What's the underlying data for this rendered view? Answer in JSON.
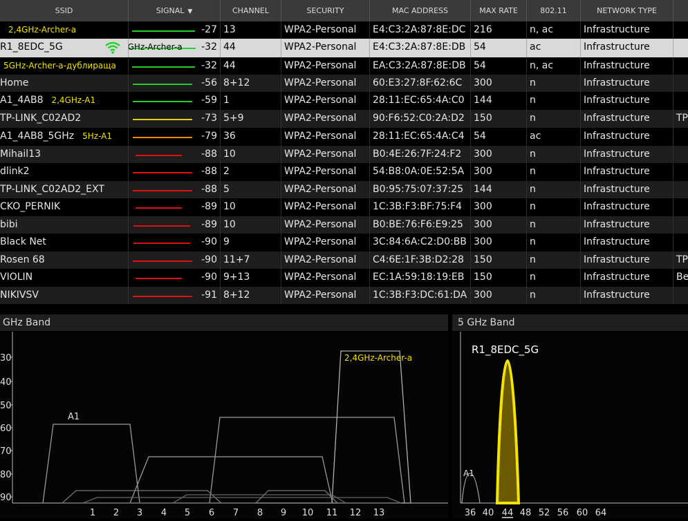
{
  "columns": [
    {
      "key": "ssid",
      "label": "SSID"
    },
    {
      "key": "signal",
      "label": "SIGNAL",
      "sort": "▼"
    },
    {
      "key": "channel",
      "label": "CHANNEL"
    },
    {
      "key": "security",
      "label": "SECURITY"
    },
    {
      "key": "mac",
      "label": "MAC ADDRESS"
    },
    {
      "key": "rate",
      "label": "MAX RATE"
    },
    {
      "key": "std",
      "label": "802.11"
    },
    {
      "key": "nettype",
      "label": "NETWORK TYPE"
    }
  ],
  "rows": [
    {
      "ssid": "",
      "note": "2,4GHz-Archer-a",
      "signal": "-27",
      "bar_fraction": 0.95,
      "bar_color": "#25d12b",
      "channel": "13",
      "security": "WPA2-Personal",
      "mac": "E4:C3:2A:87:8E:DC",
      "rate": "216",
      "std": "n, ac",
      "nettype": "Infrastructure",
      "extra": ""
    },
    {
      "ssid": "R1_8EDC_5G",
      "note": "5GHz-Archer-a",
      "signal": "-32",
      "bar_fraction": 0.95,
      "bar_color": "#25d12b",
      "channel": "44",
      "security": "WPA2-Personal",
      "mac": "E4:C3:2A:87:8E:DB",
      "rate": "54",
      "std": "ac",
      "nettype": "Infrastructure",
      "extra": "",
      "selected": true,
      "connected": true
    },
    {
      "ssid": "",
      "note": "5GHz-Archer-a-дублираща",
      "signal": "-32",
      "bar_fraction": 0.95,
      "bar_color": "#25d12b",
      "channel": "44",
      "security": "WPA2-Personal",
      "mac": "EA:C3:2A:87:8E:DB",
      "rate": "54",
      "std": "n, ac",
      "nettype": "Infrastructure",
      "extra": ""
    },
    {
      "ssid": "Home",
      "note": "",
      "signal": "-56",
      "bar_fraction": 0.9,
      "bar_color": "#25d12b",
      "channel": "8+12",
      "security": "WPA2-Personal",
      "mac": "60:E3:27:8F:62:6C",
      "rate": "300",
      "std": "n",
      "nettype": "Infrastructure",
      "extra": ""
    },
    {
      "ssid": "A1_4AB8",
      "note": "2,4GHz-A1",
      "signal": "-59",
      "bar_fraction": 0.9,
      "bar_color": "#25d12b",
      "channel": "1",
      "security": "WPA2-Personal",
      "mac": "28:11:EC:65:4A:C0",
      "rate": "144",
      "std": "n",
      "nettype": "Infrastructure",
      "extra": ""
    },
    {
      "ssid": "TP-LINK_C02AD2",
      "note": "",
      "signal": "-73",
      "bar_fraction": 0.9,
      "bar_color": "#e6d200",
      "channel": "5+9",
      "security": "WPA2-Personal",
      "mac": "90:F6:52:C0:2A:D2",
      "rate": "150",
      "std": "n",
      "nettype": "Infrastructure",
      "extra": "TP"
    },
    {
      "ssid": "A1_4AB8_5GHz",
      "note": "5Hz-A1",
      "signal": "-79",
      "bar_fraction": 0.9,
      "bar_color": "#f08a00",
      "channel": "36",
      "security": "WPA2-Personal",
      "mac": "28:11:EC:65:4A:C4",
      "rate": "54",
      "std": "ac",
      "nettype": "Infrastructure",
      "extra": ""
    },
    {
      "ssid": "Mihail13",
      "note": "",
      "signal": "-88",
      "bar_fraction": 0.7,
      "bar_color": "#e01010",
      "channel": "10",
      "security": "WPA2-Personal",
      "mac": "B0:4E:26:7F:24:F2",
      "rate": "300",
      "std": "n",
      "nettype": "Infrastructure",
      "extra": ""
    },
    {
      "ssid": "dlink2",
      "note": "",
      "signal": "-88",
      "bar_fraction": 0.9,
      "bar_color": "#e01010",
      "channel": "2",
      "security": "WPA2-Personal",
      "mac": "54:B8:0A:0E:52:5A",
      "rate": "300",
      "std": "n",
      "nettype": "Infrastructure",
      "extra": ""
    },
    {
      "ssid": "TP-LINK_C02AD2_EXT",
      "note": "",
      "signal": "-88",
      "bar_fraction": 0.9,
      "bar_color": "#e01010",
      "channel": "5",
      "security": "WPA2-Personal",
      "mac": "B0:95:75:07:37:25",
      "rate": "144",
      "std": "n",
      "nettype": "Infrastructure",
      "extra": ""
    },
    {
      "ssid": "CKO_PERNIK",
      "note": "",
      "signal": "-89",
      "bar_fraction": 0.7,
      "bar_color": "#e01010",
      "channel": "10",
      "security": "WPA2-Personal",
      "mac": "1C:3B:F3:BF:75:F4",
      "rate": "300",
      "std": "n",
      "nettype": "Infrastructure",
      "extra": ""
    },
    {
      "ssid": "bibi",
      "note": "",
      "signal": "-89",
      "bar_fraction": 0.85,
      "bar_color": "#e01010",
      "channel": "10",
      "security": "WPA2-Personal",
      "mac": "B0:BE:76:F6:E9:25",
      "rate": "300",
      "std": "n",
      "nettype": "Infrastructure",
      "extra": ""
    },
    {
      "ssid": "Black Net",
      "note": "",
      "signal": "-90",
      "bar_fraction": 0.85,
      "bar_color": "#e01010",
      "channel": "9",
      "security": "WPA2-Personal",
      "mac": "3C:84:6A:C2:D0:BB",
      "rate": "300",
      "std": "n",
      "nettype": "Infrastructure",
      "extra": ""
    },
    {
      "ssid": "Rosen 68",
      "note": "",
      "signal": "-90",
      "bar_fraction": 0.9,
      "bar_color": "#e01010",
      "channel": "11+7",
      "security": "WPA2-Personal",
      "mac": "C4:6E:1F:3B:D2:28",
      "rate": "150",
      "std": "n",
      "nettype": "Infrastructure",
      "extra": "TP"
    },
    {
      "ssid": "VIOLIN",
      "note": "",
      "signal": "-90",
      "bar_fraction": 0.7,
      "bar_color": "#e01010",
      "channel": "9+13",
      "security": "WPA2-Personal",
      "mac": "EC:1A:59:18:19:EB",
      "rate": "150",
      "std": "n",
      "nettype": "Infrastructure",
      "extra": "Be"
    },
    {
      "ssid": "NIKIVSV",
      "note": "",
      "signal": "-91",
      "bar_fraction": 0.9,
      "bar_color": "#e01010",
      "channel": "8+12",
      "security": "WPA2-Personal",
      "mac": "1C:3B:F3:DC:61:DA",
      "rate": "300",
      "std": "n",
      "nettype": "Infrastructure",
      "extra": ""
    }
  ],
  "band24": {
    "title": "GHz Band",
    "ylabels": [
      "30",
      "40",
      "50",
      "60",
      "70",
      "80",
      "90"
    ],
    "channels": [
      "1",
      "2",
      "3",
      "4",
      "5",
      "6",
      "7",
      "8",
      "9",
      "10",
      "11",
      "12",
      "13"
    ],
    "labels": [
      {
        "text": "A1",
        "color": "#dcdcdc"
      },
      {
        "text": "2,4GHz-Archer-a",
        "color": "#f2e400"
      }
    ]
  },
  "band5": {
    "title": "5 GHz Band",
    "net_label": "R1_8EDC_5G",
    "a1_label": "A1",
    "channels": [
      "36",
      "40",
      "44",
      "48",
      "52",
      "56",
      "60",
      "64"
    ],
    "highlight_channel": "44"
  },
  "colors": {
    "strong": "#25d12b",
    "medium": "#e6d200",
    "weak": "#f08a00",
    "poor": "#e01010",
    "highlight": "#f2e400"
  },
  "icons": {
    "connected": "wifi-icon",
    "sort": "sort-desc-icon"
  }
}
